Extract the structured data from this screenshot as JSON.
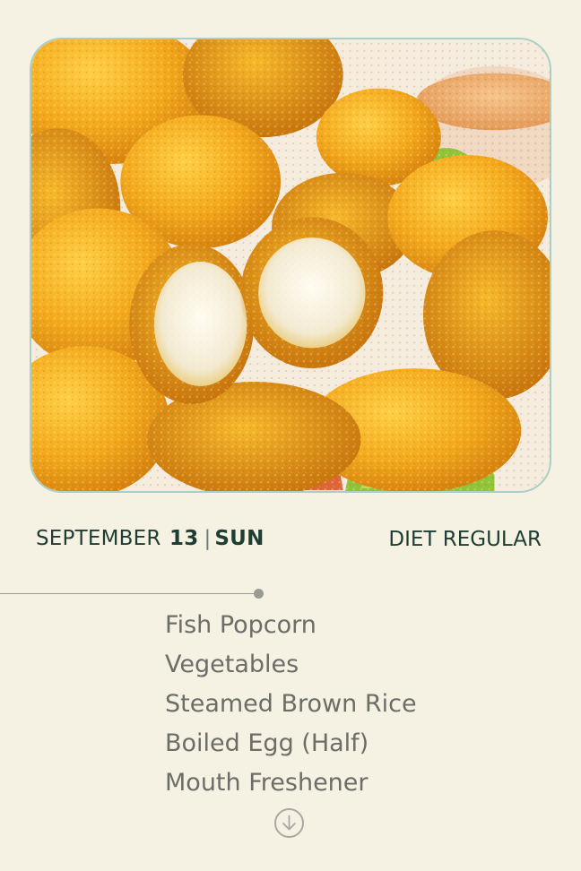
{
  "hero_image": {
    "description_icon": "fish-popcorn-photo"
  },
  "date": {
    "month": "SEPTEMBER",
    "day": "13",
    "separator": "|",
    "weekday": "SUN"
  },
  "diet": {
    "label": "DIET REGULAR"
  },
  "menu": {
    "items": [
      "Fish Popcorn",
      "Vegetables",
      "Steamed Brown Rice",
      "Boiled Egg (Half)",
      "Mouth Freshener"
    ]
  },
  "scroll_button": {
    "icon": "arrow-down-circle-icon"
  },
  "colors": {
    "background": "#f5f2e3",
    "text_dark": "#1f3d33",
    "text_muted": "#6d6d68",
    "frame_border": "#a9cfc8"
  }
}
